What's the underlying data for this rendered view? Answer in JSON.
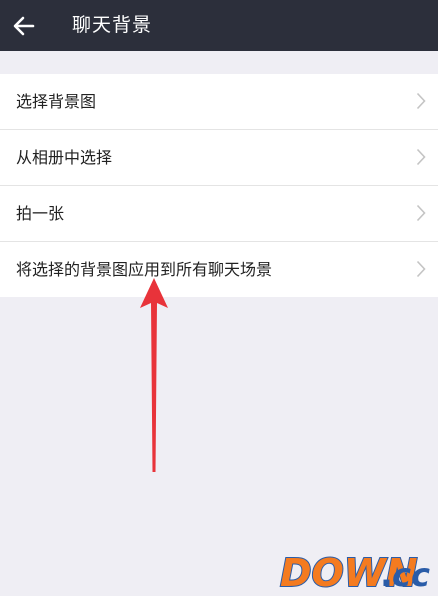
{
  "header": {
    "title": "聊天背景",
    "back_icon": "arrow-left-icon"
  },
  "menu": {
    "items": [
      {
        "label": "选择背景图"
      },
      {
        "label": "从相册中选择"
      },
      {
        "label": "拍一张"
      },
      {
        "label": "将选择的背景图应用到所有聊天场景"
      }
    ]
  },
  "watermark": {
    "text_main": "DOWN",
    "text_dot": ".",
    "text_suffix": "cc"
  },
  "colors": {
    "header_bg": "#2c2f3b",
    "page_bg": "#efeef4",
    "annotation_arrow": "#e8333a",
    "watermark_orange": "#f47b20",
    "watermark_blue": "#2a5ca8"
  }
}
